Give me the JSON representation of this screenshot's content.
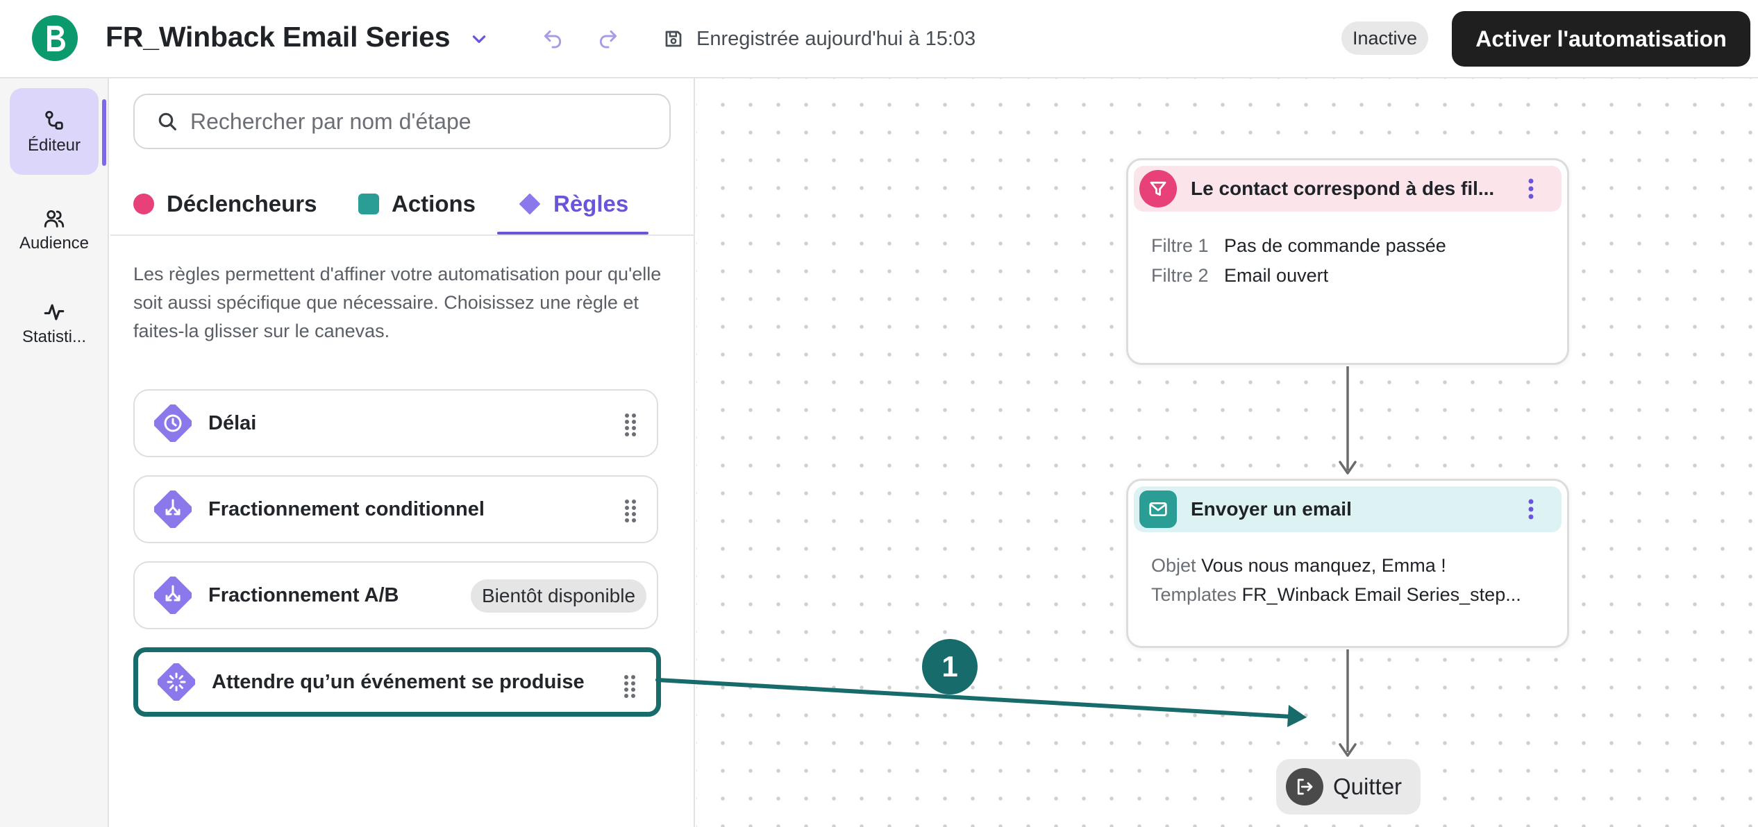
{
  "header": {
    "title": "FR_Winback Email Series",
    "saved_text": "Enregistrée aujourd'hui à 15:03",
    "status": "Inactive",
    "activate_label": "Activer l'automatisation"
  },
  "leftnav": {
    "items": [
      {
        "label": "Éditeur",
        "icon": "workflow-icon",
        "active": true
      },
      {
        "label": "Audience",
        "icon": "users-icon",
        "active": false
      },
      {
        "label": "Statisti...",
        "icon": "activity-icon",
        "active": false
      }
    ]
  },
  "sidebar": {
    "search_placeholder": "Rechercher par nom d'étape",
    "tabs": [
      {
        "label": "Déclencheurs",
        "color": "#e8417a"
      },
      {
        "label": "Actions",
        "color": "#2a9d95"
      },
      {
        "label": "Règles",
        "color": "#7c68e8",
        "active": true
      }
    ],
    "description": "Les règles permettent d'affiner votre automatisation pour qu'elle soit aussi spécifique que nécessaire. Choisissez une règle et faites-la glisser sur le canevas.",
    "rules": [
      {
        "label": "Délai",
        "icon": "clock-icon"
      },
      {
        "label": "Fractionnement conditionnel",
        "icon": "split-icon"
      },
      {
        "label": "Fractionnement A/B",
        "icon": "split-icon",
        "badge": "Bientôt disponible"
      },
      {
        "label": "Attendre qu’un événement se produise",
        "icon": "loading-icon",
        "highlighted": true
      }
    ]
  },
  "canvas": {
    "filter_node": {
      "title": "Le contact correspond à des fil...",
      "rows": [
        {
          "key": "Filtre 1",
          "value": "Pas de commande passée"
        },
        {
          "key": "Filtre 2",
          "value": "Email ouvert"
        }
      ]
    },
    "email_node": {
      "title": "Envoyer un email",
      "rows": [
        {
          "key": "Objet",
          "value": "Vous nous manquez, Emma !"
        },
        {
          "key": "Templates",
          "value": "FR_Winback Email Series_step..."
        }
      ]
    },
    "exit_node": {
      "label": "Quitter"
    },
    "annotation": {
      "number": "1",
      "color": "#176b6a"
    }
  },
  "colors": {
    "brand": "#0b996e",
    "accent": "#6a55d8",
    "trigger": "#e8417a",
    "action": "#2a9d95"
  }
}
